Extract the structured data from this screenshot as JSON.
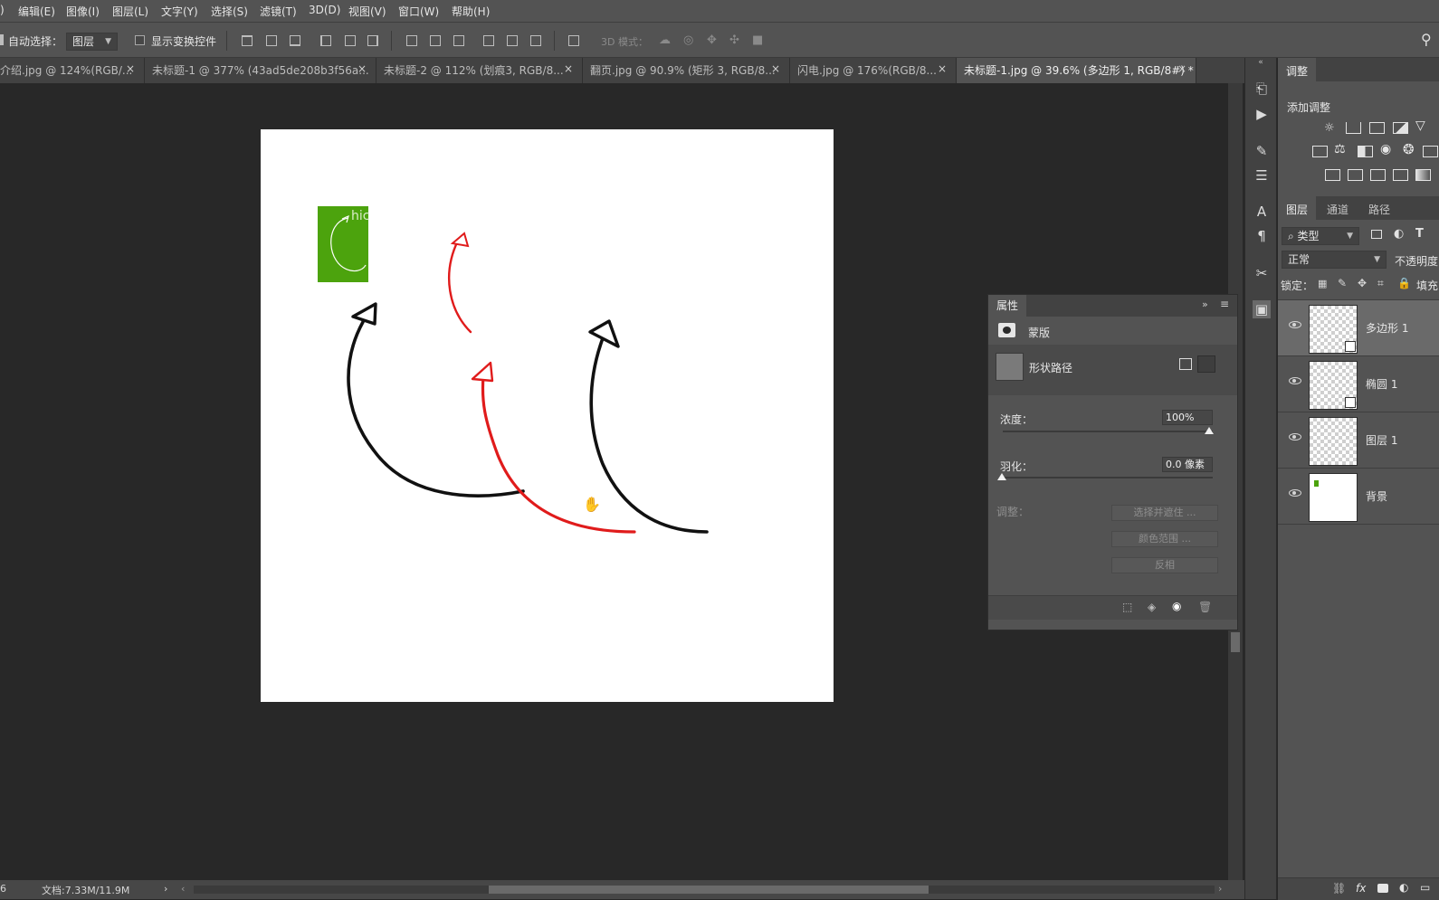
{
  "menu": [
    "编辑(E)",
    "图像(I)",
    "图层(L)",
    "文字(Y)",
    "选择(S)",
    "滤镜(T)",
    "3D(D)",
    "视图(V)",
    "窗口(W)",
    "帮助(H)"
  ],
  "options": {
    "auto_select_label": "自动选择：",
    "auto_select_value": "图层",
    "show_transform_label": "显示变换控件",
    "mode_3d_label": "3D 模式："
  },
  "tabs": [
    {
      "label": "介绍.jpg @ 124%(RGB/...",
      "active": false
    },
    {
      "label": "未标题-1 @ 377% (43ad5de208b3f56a...",
      "active": false
    },
    {
      "label": "未标题-2 @ 112% (划痕3, RGB/8...",
      "active": false
    },
    {
      "label": "翻页.jpg @ 90.9% (矩形 3, RGB/8...",
      "active": false
    },
    {
      "label": "闪电.jpg @ 176%(RGB/8...",
      "active": false
    },
    {
      "label": "未标题-1.jpg @ 39.6% (多边形 1, RGB/8#) *",
      "active": true
    }
  ],
  "status": {
    "doc_size": "文档:7.33M/11.9M"
  },
  "adjustments": {
    "tab_label": "调整",
    "add_label": "添加调整"
  },
  "layers_panel": {
    "tabs": [
      "图层",
      "通道",
      "路径"
    ],
    "filter_label": "类型",
    "blend_mode": "正常",
    "opacity_label": "不透明度",
    "lock_label": "锁定：",
    "fill_label": "填充",
    "layers": [
      {
        "name": "多边形 1",
        "selected": true
      },
      {
        "name": "椭圆 1",
        "selected": false
      },
      {
        "name": "图层 1",
        "selected": false
      },
      {
        "name": "背景",
        "selected": false
      }
    ]
  },
  "properties": {
    "title": "属性",
    "mask_label": "蒙版",
    "shape_path_label": "形状路径",
    "density_label": "浓度：",
    "density_value": "100%",
    "feather_label": "羽化：",
    "feather_value": "0.0 像素",
    "adjust_label": "调整：",
    "select_and_mask": "选择并遮住 ...",
    "color_range": "颜色范围 ...",
    "invert": "反相"
  },
  "colors": {
    "green_swatch": "#4ca30d",
    "red_arrow": "#e01b1b",
    "black_arrow": "#111111"
  },
  "artwork_text": "hic"
}
